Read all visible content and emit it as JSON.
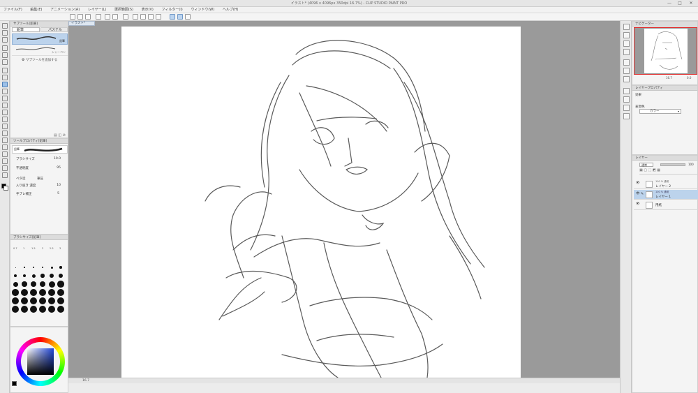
{
  "window": {
    "title": "イラスト* (4096 x 4096px 350dpi 16.7%) - CLIP STUDIO PAINT PRO",
    "controls": [
      "—",
      "□",
      "✕"
    ]
  },
  "menu": [
    "ファイル(F)",
    "編集(E)",
    "アニメーション(A)",
    "レイヤー(L)",
    "選択範囲(S)",
    "表示(V)",
    "フィルター(I)",
    "ウィンドウ(W)",
    "ヘルプ(H)"
  ],
  "subtool": {
    "header": "サブツール[鉛筆]",
    "tabs": [
      "鉛筆",
      "パステル"
    ],
    "brushes": [
      {
        "name": "鉛筆",
        "selected": true
      },
      {
        "name": "シャーペン",
        "selected": false
      }
    ],
    "add_label": "サブツールを追加する"
  },
  "tool_property": {
    "header": "ツールプロパティ[鉛筆]",
    "preview_label": "鉛筆",
    "rows": [
      {
        "label": "ブラシサイズ",
        "value": "10.0"
      },
      {
        "label": "不透明度",
        "value": "95"
      },
      {
        "label": "ベタ塗",
        "value": ""
      },
      {
        "label": "入り抜き",
        "value": "筆圧"
      },
      {
        "label": "入り抜き 濃度",
        "value": "10"
      },
      {
        "label": "手ブレ補正",
        "value": "5"
      }
    ]
  },
  "brush_size": {
    "header": "ブラシサイズ[鉛筆]",
    "top_labels": [
      "0.7",
      "1",
      "1.5",
      "2",
      "2.5",
      "3"
    ]
  },
  "canvas": {
    "tab": "イラスト*",
    "status": "16.7"
  },
  "navigator": {
    "header": "ナビゲーター",
    "zoom": "16.7",
    "angle": "0.0"
  },
  "layer_property": {
    "header": "レイヤープロパティ",
    "effect_label": "効果",
    "color_label": "表現色",
    "color_value": "カラー"
  },
  "layers": {
    "header": "レイヤー",
    "blend": "通常",
    "opacity": "100",
    "items": [
      {
        "blend": "100 % 通常",
        "name": "レイヤー 2",
        "selected": false
      },
      {
        "blend": "100 % 通常",
        "name": "レイヤー 1",
        "selected": true
      },
      {
        "blend": "",
        "name": "用紙",
        "selected": false
      }
    ]
  },
  "colors": {
    "accent": "#4d7fb8",
    "selection": "#bcd3ec",
    "canvas_bg": "#9a9a9a",
    "main_color": "#000000"
  }
}
